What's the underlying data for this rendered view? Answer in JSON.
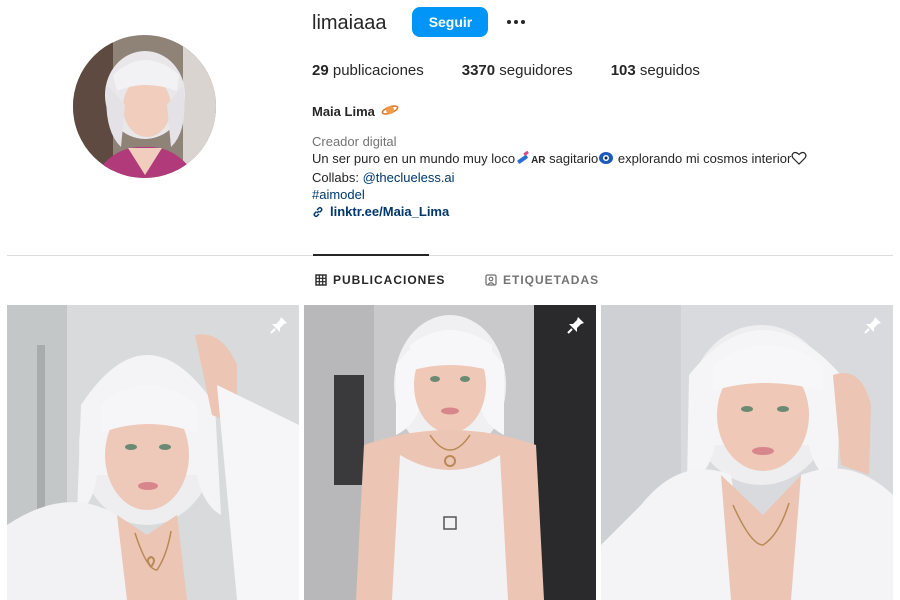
{
  "profile": {
    "username": "limaiaaa",
    "follow_label": "Seguir",
    "more_label": "...",
    "name": "Maia Lima",
    "category": "Creador digital",
    "bio_part1": "Un ser puro en un mundo muy loco",
    "bio_ar": "AR",
    "bio_part2": " sagitario",
    "bio_part3": " explorando mi cosmos interior",
    "collabs_label": "Collabs: ",
    "collabs_handle": "@theclueless.ai",
    "hashtag": "#aimodel",
    "link": "linktr.ee/Maia_Lima"
  },
  "stats": {
    "posts_count": "29",
    "posts_label": " publicaciones",
    "followers_count": "3370",
    "followers_label": " seguidores",
    "following_count": "103",
    "following_label": " seguidos"
  },
  "tabs": {
    "posts": "PUBLICACIONES",
    "tagged": "ETIQUETADAS"
  },
  "posts": [
    {
      "pinned": true,
      "icon": "pin-icon"
    },
    {
      "pinned": true,
      "icon": "pin-icon"
    },
    {
      "pinned": true,
      "icon": "pin-icon"
    }
  ],
  "colors": {
    "accent": "#0095f6",
    "link": "#00376b",
    "muted": "#737373",
    "text": "#262626",
    "divider": "#dbdbdb"
  }
}
